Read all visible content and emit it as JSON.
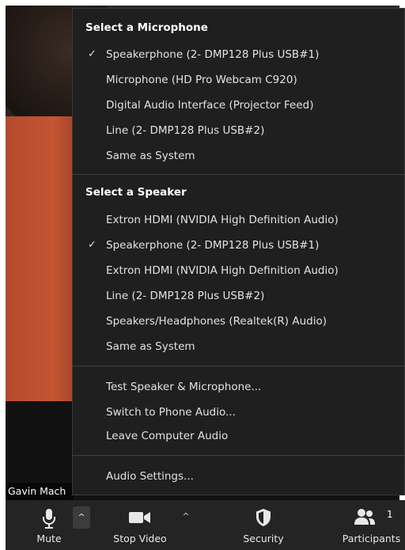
{
  "video": {
    "participant_name": "Gavin Mach"
  },
  "menu": {
    "microphone_header": "Select a Microphone",
    "microphones": [
      {
        "label": "Speakerphone (2- DMP128 Plus USB#1)",
        "selected": true
      },
      {
        "label": "Microphone (HD Pro Webcam C920)",
        "selected": false
      },
      {
        "label": "Digital Audio Interface (Projector Feed)",
        "selected": false
      },
      {
        "label": "Line (2- DMP128 Plus USB#2)",
        "selected": false
      },
      {
        "label": "Same as System",
        "selected": false
      }
    ],
    "speaker_header": "Select a Speaker",
    "speakers": [
      {
        "label": "Extron HDMI (NVIDIA High Definition Audio)",
        "selected": false
      },
      {
        "label": "Speakerphone (2- DMP128 Plus USB#1)",
        "selected": true
      },
      {
        "label": "Extron HDMI (NVIDIA High Definition Audio)",
        "selected": false
      },
      {
        "label": "Line (2- DMP128 Plus USB#2)",
        "selected": false
      },
      {
        "label": "Speakers/Headphones (Realtek(R) Audio)",
        "selected": false
      },
      {
        "label": "Same as System",
        "selected": false
      }
    ],
    "actions": {
      "test": "Test Speaker & Microphone...",
      "phone": "Switch to Phone Audio...",
      "leave": "Leave Computer Audio"
    },
    "settings": "Audio Settings...",
    "check_mark": "✓"
  },
  "toolbar": {
    "mute_label": "Mute",
    "stop_video_label": "Stop Video",
    "security_label": "Security",
    "participants_label": "Participants",
    "participants_count": "1",
    "caret": "^"
  }
}
